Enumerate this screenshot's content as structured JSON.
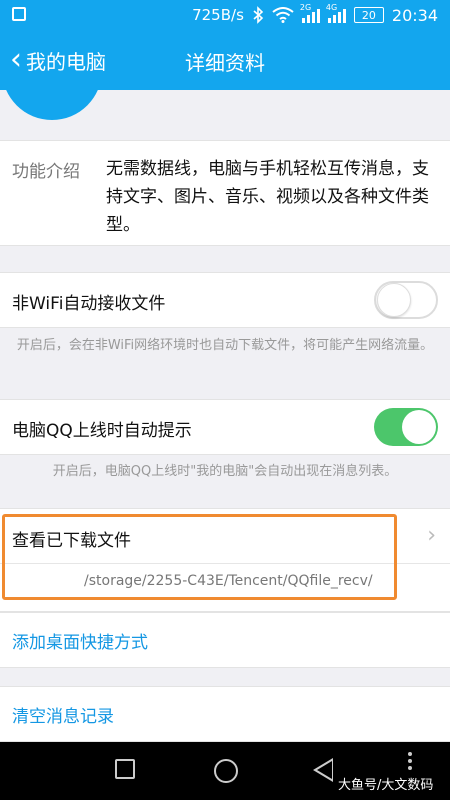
{
  "status_bar": {
    "net_speed": "725B/s",
    "signal_1_tag": "2G",
    "signal_2_tag": "4G",
    "battery": "20",
    "time": "20:34"
  },
  "nav": {
    "back_label": "我的电脑",
    "title": "详细资料"
  },
  "intro": {
    "label": "功能介绍",
    "text": "无需数据线，电脑与手机轻松互传消息，支持文字、图片、音乐、视频以及各种文件类型。"
  },
  "settings": {
    "wifi_receive": {
      "label": "非WiFi自动接收文件",
      "enabled": false,
      "description": "开启后，会在非WiFi网络环境时也自动下载文件，将可能产生网络流量。"
    },
    "pc_online": {
      "label": "电脑QQ上线时自动提示",
      "enabled": true,
      "description": "开启后，电脑QQ上线时\"我的电脑\"会自动出现在消息列表。"
    }
  },
  "downloads": {
    "label": "查看已下载文件",
    "path": "/storage/2255-C43E/Tencent/QQfile_recv/"
  },
  "actions": {
    "add_shortcut": "添加桌面快捷方式",
    "clear_history": "清空消息记录"
  },
  "watermark": "大鱼号/大文数码",
  "colors": {
    "primary": "#13a6ee",
    "toggle_on": "#4cc66b",
    "link": "#1497e3",
    "highlight": "#f08a30"
  },
  "icons": {
    "back": "chevron-left-icon",
    "bluetooth": "bluetooth-icon",
    "wifi": "wifi-icon",
    "chevron": "chevron-right-icon"
  }
}
